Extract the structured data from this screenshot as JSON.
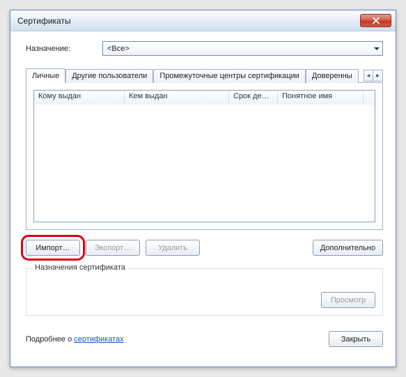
{
  "window": {
    "title": "Сертификаты"
  },
  "purpose": {
    "label": "Назначение:",
    "value": "<Все>"
  },
  "tabs": {
    "items": [
      {
        "label": "Личные",
        "active": true
      },
      {
        "label": "Другие пользователи",
        "active": false
      },
      {
        "label": "Промежуточные центры сертификации",
        "active": false
      },
      {
        "label": "Доверенны",
        "active": false
      }
    ],
    "spin_left": "◂",
    "spin_right": "▸"
  },
  "list": {
    "columns": {
      "issued_to": "Кому выдан",
      "issued_by": "Кем выдан",
      "expires": "Срок де…",
      "friendly": "Понятное имя"
    }
  },
  "buttons": {
    "import": "Импорт…",
    "export": "Экспорт…",
    "delete": "Удалить",
    "advanced": "Дополнительно",
    "view": "Просмотр",
    "close": "Закрыть"
  },
  "group": {
    "legend": "Назначения сертификата"
  },
  "footer": {
    "prefix": "Подробнее о ",
    "link": "сертификатах"
  }
}
